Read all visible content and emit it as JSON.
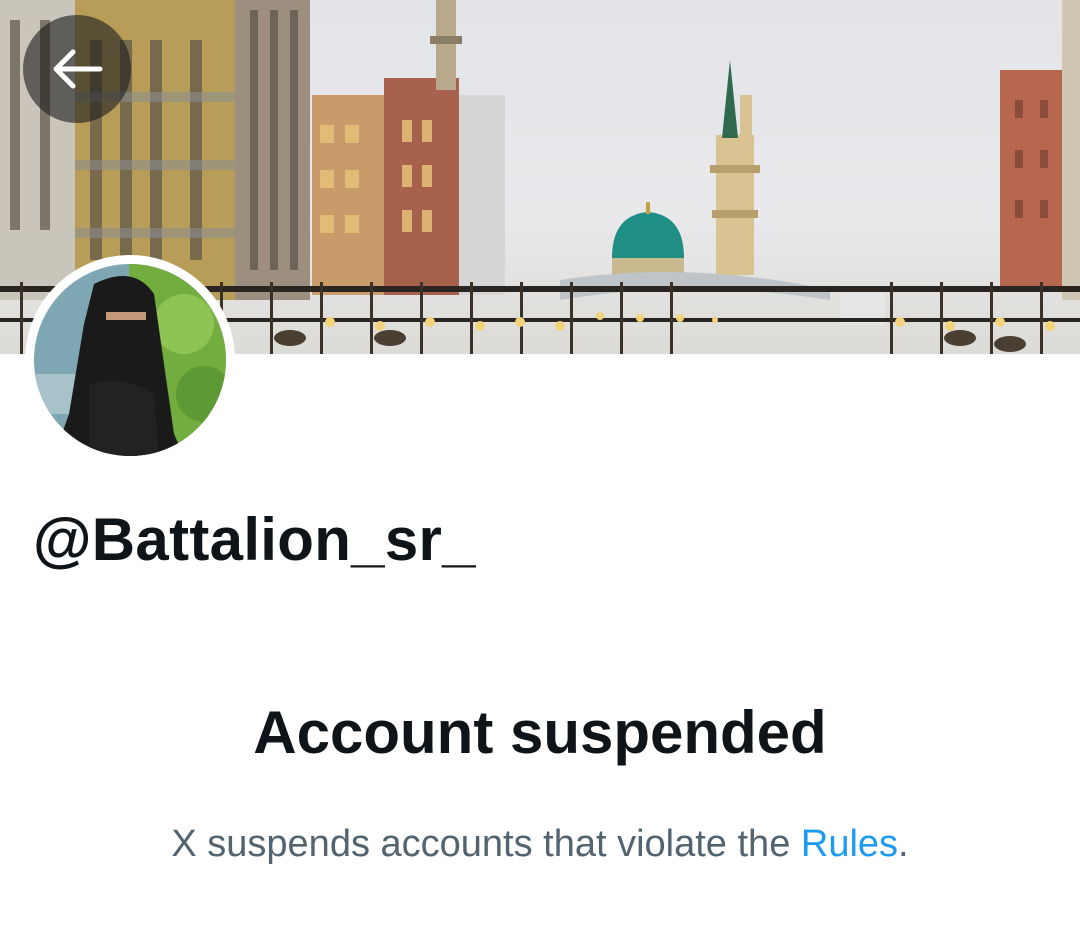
{
  "header": {
    "back_icon": "arrow-left-icon",
    "banner_image": "city-skyline-with-green-dome-mosque"
  },
  "profile": {
    "avatar": "veiled-person-avatar",
    "handle": "@Battalion_sr_"
  },
  "suspension": {
    "headline": "Account suspended",
    "message_before": "X suspends accounts that violate the ",
    "rules_link": "Rules",
    "message_after": "."
  },
  "colors": {
    "text_primary": "#0f1419",
    "text_secondary": "#536471",
    "link": "#1d9bf0",
    "dome": "#1f8f86"
  }
}
